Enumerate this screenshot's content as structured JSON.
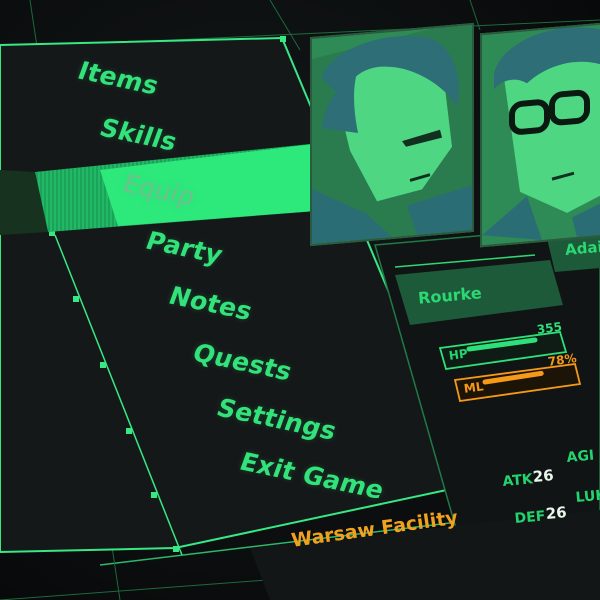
{
  "menu": {
    "items": [
      {
        "label": "Items"
      },
      {
        "label": "Skills"
      },
      {
        "label": "Equip"
      },
      {
        "label": "Party"
      },
      {
        "label": "Notes"
      },
      {
        "label": "Quests"
      },
      {
        "label": "Settings"
      },
      {
        "label": "Exit Game"
      }
    ],
    "selected_index": 2
  },
  "party": {
    "members": [
      {
        "name": "Rourke",
        "hp_label": "HP",
        "hp_value": "355",
        "ml_label": "ML",
        "ml_value": "78%",
        "ml_fill": 0.78,
        "stats": {
          "atk_label": "ATK",
          "atk_value": "26",
          "def_label": "DEF",
          "def_value": "26",
          "agi_label": "AGI",
          "luk_label": "LUK"
        }
      },
      {
        "name": "Adair"
      }
    ]
  },
  "location": {
    "name": "Warsaw Facility"
  },
  "colors": {
    "accent_green": "#2fe07a",
    "highlight_green": "#36f08a",
    "dark_green": "#1f6b3f",
    "hp_green": "#2ee07a",
    "ml_orange": "#f59a18",
    "location_orange": "#f0a11d",
    "background": "#0c0f10"
  }
}
